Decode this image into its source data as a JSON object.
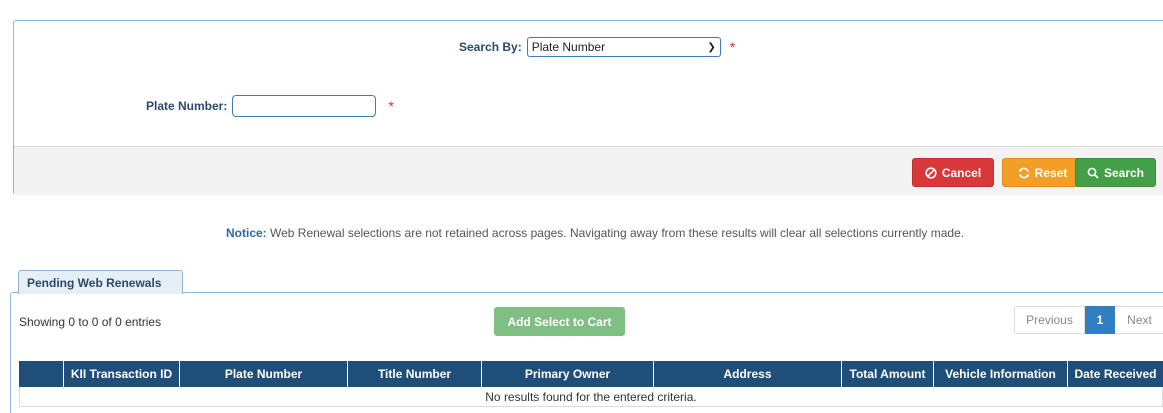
{
  "search": {
    "search_by_label": "Search By:",
    "search_by_value": "Plate Number",
    "required_mark": "*",
    "plate_label": "Plate Number:",
    "plate_value": ""
  },
  "actions": {
    "cancel_label": "Cancel",
    "reset_label": "Reset",
    "search_label": "Search"
  },
  "notice": {
    "prefix": "Notice:",
    "text": " Web Renewal selections are not retained across pages. Navigating away from these results will clear all selections currently made."
  },
  "tab": {
    "label": "Pending Web Renewals"
  },
  "results": {
    "showing": "Showing 0 to 0 of 0 entries",
    "add_to_cart_label": "Add Select to Cart",
    "pager": {
      "previous": "Previous",
      "current": "1",
      "next": "Next"
    },
    "columns": [
      "",
      "KII Transaction ID",
      "Plate Number",
      "Title Number",
      "Primary Owner",
      "Address",
      "Total Amount",
      "Vehicle Information",
      "Date Received"
    ],
    "empty_message": "No results found for the entered criteria."
  },
  "colors": {
    "cancel": "#d9383a",
    "reset": "#f29e27",
    "search": "#43a047",
    "table_header": "#1f4e79",
    "pager_active": "#2f7fc1"
  }
}
